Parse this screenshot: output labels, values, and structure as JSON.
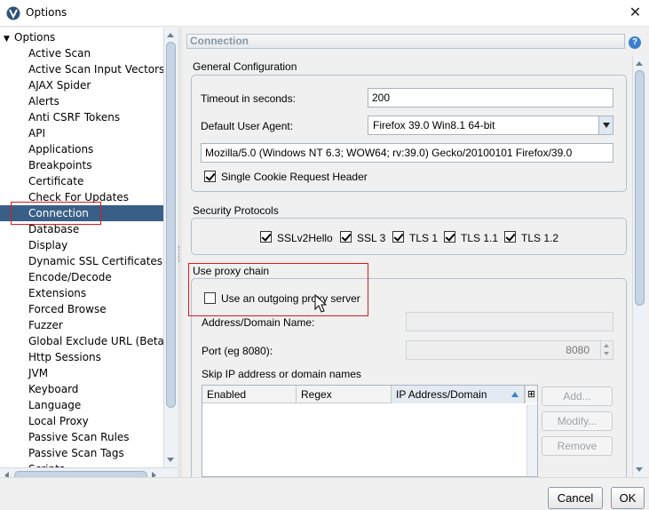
{
  "window": {
    "title": "Options",
    "close_glyph": "✕"
  },
  "tree": {
    "root_label": "Options",
    "items": [
      {
        "label": "Active Scan",
        "selected": false
      },
      {
        "label": "Active Scan Input Vectors",
        "selected": false
      },
      {
        "label": "AJAX Spider",
        "selected": false
      },
      {
        "label": "Alerts",
        "selected": false
      },
      {
        "label": "Anti CSRF Tokens",
        "selected": false
      },
      {
        "label": "API",
        "selected": false
      },
      {
        "label": "Applications",
        "selected": false
      },
      {
        "label": "Breakpoints",
        "selected": false
      },
      {
        "label": "Certificate",
        "selected": false
      },
      {
        "label": "Check For Updates",
        "selected": false
      },
      {
        "label": "Connection",
        "selected": true
      },
      {
        "label": "Database",
        "selected": false
      },
      {
        "label": "Display",
        "selected": false
      },
      {
        "label": "Dynamic SSL Certificates",
        "selected": false
      },
      {
        "label": "Encode/Decode",
        "selected": false
      },
      {
        "label": "Extensions",
        "selected": false
      },
      {
        "label": "Forced Browse",
        "selected": false
      },
      {
        "label": "Fuzzer",
        "selected": false
      },
      {
        "label": "Global Exclude URL (Beta)",
        "selected": false
      },
      {
        "label": "Http Sessions",
        "selected": false
      },
      {
        "label": "JVM",
        "selected": false
      },
      {
        "label": "Keyboard",
        "selected": false
      },
      {
        "label": "Language",
        "selected": false
      },
      {
        "label": "Local Proxy",
        "selected": false
      },
      {
        "label": "Passive Scan Rules",
        "selected": false
      },
      {
        "label": "Passive Scan Tags",
        "selected": false
      },
      {
        "label": "Scripts",
        "selected": false
      }
    ]
  },
  "panel": {
    "header": "Connection",
    "help_glyph": "?",
    "general": {
      "title": "General Configuration",
      "timeout_label": "Timeout in seconds:",
      "timeout_value": "200",
      "user_agent_label": "Default User Agent:",
      "user_agent_selected": "Firefox 39.0 Win8.1 64-bit",
      "user_agent_string": "Mozilla/5.0 (Windows NT 6.3; WOW64; rv:39.0) Gecko/20100101 Firefox/39.0",
      "single_cookie_label": "Single Cookie Request Header",
      "single_cookie_checked": true
    },
    "security": {
      "title": "Security Protocols",
      "protocols": [
        {
          "label": "SSLv2Hello",
          "checked": true
        },
        {
          "label": "SSL 3",
          "checked": true
        },
        {
          "label": "TLS 1",
          "checked": true
        },
        {
          "label": "TLS 1.1",
          "checked": true
        },
        {
          "label": "TLS 1.2",
          "checked": true
        }
      ]
    },
    "proxy": {
      "title": "Use proxy chain",
      "use_proxy_label": "Use an outgoing proxy server",
      "use_proxy_checked": false,
      "address_label": "Address/Domain Name:",
      "address_value": "",
      "port_label": "Port (eg 8080):",
      "port_value": "8080",
      "skip_label": "Skip IP address or domain names",
      "table": {
        "columns": [
          "Enabled",
          "Regex",
          "IP Address/Domain"
        ],
        "sorted_column": "IP Address/Domain",
        "rows": []
      },
      "buttons": {
        "add": "Add...",
        "modify": "Modify...",
        "remove": "Remove"
      }
    }
  },
  "footer": {
    "cancel": "Cancel",
    "ok": "OK"
  },
  "colors": {
    "selection": "#3a5f86",
    "highlight_box": "#e2161e",
    "group_border": "#b5c0cc"
  }
}
